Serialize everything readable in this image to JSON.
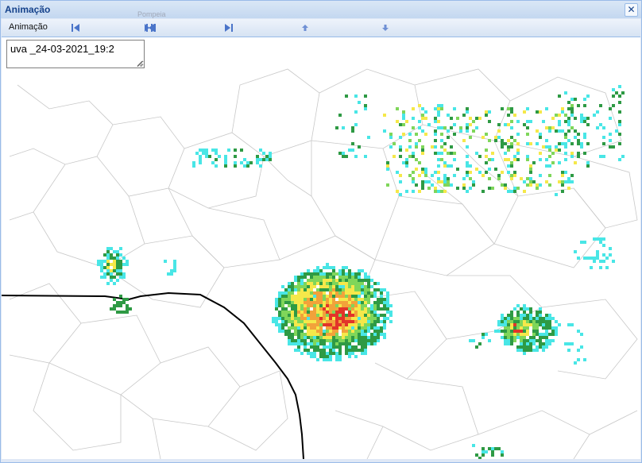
{
  "window": {
    "title": "Animação",
    "close_icon": "close-icon"
  },
  "map_label": "Pompeia",
  "toolbar": {
    "label": "Animação",
    "buttons": [
      {
        "name": "first-frame",
        "icon": "skip-to-start-icon"
      },
      {
        "name": "play-pause",
        "icon": "play-pause-icon"
      },
      {
        "name": "next-frame",
        "icon": "step-forward-icon"
      },
      {
        "name": "speed-up",
        "icon": "arrow-up-icon"
      },
      {
        "name": "speed-down",
        "icon": "arrow-down-icon"
      }
    ]
  },
  "frame_info": {
    "value": "uva _24-03-2021_19:2"
  },
  "colors": {
    "window_border": "#99bbe8",
    "title_text": "#15428b",
    "toolbar_icon": "#4a74c9",
    "radar_cyan": "#49e6e6",
    "radar_green": "#2e9a44",
    "radar_lightgreen": "#7fd65a",
    "radar_yellow": "#f5e84a",
    "radar_orange": "#f2a23a",
    "radar_red": "#e2342a",
    "border_line": "#000000",
    "municipal_lines": "#c8c8c8"
  }
}
